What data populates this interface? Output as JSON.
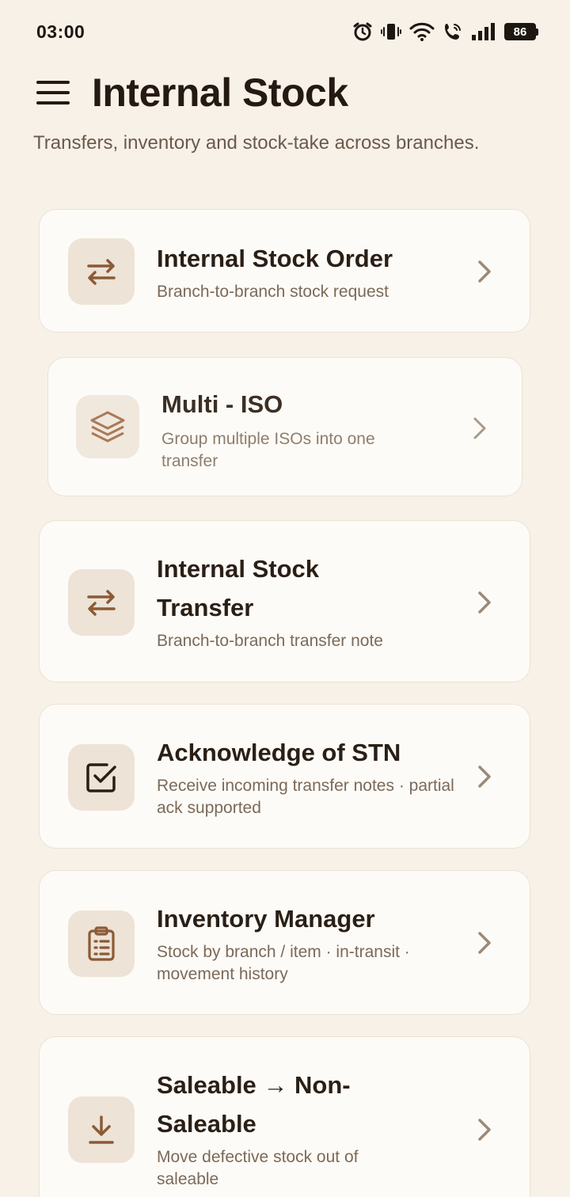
{
  "status": {
    "time": "03:00",
    "battery": "86"
  },
  "header": {
    "title": "Internal Stock",
    "subtitle": "Transfers, inventory and stock-take across branches."
  },
  "items": [
    {
      "title": "Internal Stock Order",
      "desc": "Branch-to-branch stock request",
      "icon": "transfer-arrows-icon"
    },
    {
      "title": "Multi - ISO",
      "desc": "Group multiple ISOs into one transfer",
      "icon": "layers-icon"
    },
    {
      "title": "Internal Stock Transfer",
      "desc": "Branch-to-branch transfer note",
      "icon": "transfer-arrows-icon"
    },
    {
      "title": "Acknowledge of STN",
      "desc": "Receive incoming transfer notes · partial ack supported",
      "icon": "checkbox-icon"
    },
    {
      "title": "Inventory Manager",
      "desc": "Stock by branch / item · in-transit · movement history",
      "icon": "clipboard-icon"
    },
    {
      "title": "Saleable → Non-Saleable",
      "desc": "Move defective stock out of saleable",
      "icon": "download-icon"
    }
  ],
  "colors": {
    "background": "#f7f1e8",
    "card": "#fdfbf7",
    "icon_tile": "#ede3d6",
    "accent": "#8b5a36"
  }
}
